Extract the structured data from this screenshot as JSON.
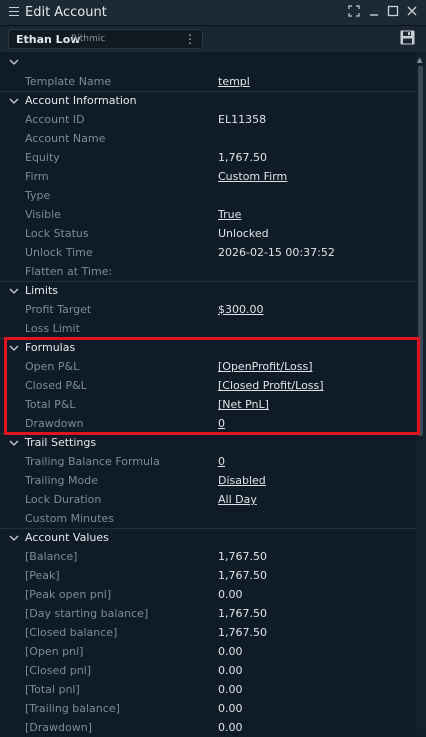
{
  "window": {
    "title": "Edit Account",
    "controls": [
      "maximize-icon",
      "minimize-icon",
      "restore-icon",
      "close-icon"
    ]
  },
  "account_selector": {
    "name": "Ethan Low",
    "provider": "Rithmic"
  },
  "colors": {
    "background": "#0f1c27",
    "label": "#7f8a94",
    "value": "#dfe3e6",
    "highlight": "#e0141f"
  },
  "grid": {
    "top": {
      "rows": [
        {
          "label": "Template Name",
          "value": "templ",
          "link": true
        }
      ]
    },
    "account_information": {
      "title": "Account Information",
      "rows": [
        {
          "label": "Account ID",
          "value": "EL11358",
          "link": false
        },
        {
          "label": "Account Name",
          "value": "",
          "link": false
        },
        {
          "label": "Equity",
          "value": "1,767.50",
          "link": false
        },
        {
          "label": "Firm",
          "value": "Custom Firm",
          "link": true
        },
        {
          "label": "Type",
          "value": "",
          "link": false
        },
        {
          "label": "Visible",
          "value": "True",
          "link": true
        },
        {
          "label": "Lock Status",
          "value": "Unlocked",
          "link": false
        },
        {
          "label": "Unlock Time",
          "value": "2026-02-15 00:37:52",
          "link": false
        },
        {
          "label": "Flatten at Time:",
          "value": "",
          "link": false
        }
      ]
    },
    "limits": {
      "title": "Limits",
      "rows": [
        {
          "label": "Profit Target",
          "value": "$300.00",
          "link": true
        },
        {
          "label": "Loss Limit",
          "value": "",
          "link": false
        }
      ]
    },
    "formulas": {
      "title": "Formulas",
      "rows": [
        {
          "label": "Open P&L",
          "value": "[OpenProfit/Loss]",
          "link": true
        },
        {
          "label": "Closed P&L",
          "value": "[Closed Profit/Loss]",
          "link": true
        },
        {
          "label": "Total P&L",
          "value": "[Net PnL]",
          "link": true
        },
        {
          "label": "Drawdown",
          "value": "0",
          "link": true
        }
      ]
    },
    "trail_settings": {
      "title": "Trail Settings",
      "rows": [
        {
          "label": "Trailing Balance Formula",
          "value": "0",
          "link": true
        },
        {
          "label": "Trailing Mode",
          "value": "Disabled",
          "link": true
        },
        {
          "label": "Lock Duration",
          "value": "All Day",
          "link": true
        },
        {
          "label": "Custom Minutes",
          "value": "",
          "link": false
        }
      ]
    },
    "account_values": {
      "title": "Account Values",
      "rows": [
        {
          "label": "[Balance]",
          "value": "1,767.50",
          "link": false
        },
        {
          "label": "[Peak]",
          "value": "1,767.50",
          "link": false
        },
        {
          "label": "[Peak open pnl]",
          "value": "0.00",
          "link": false
        },
        {
          "label": "[Day starting balance]",
          "value": "1,767.50",
          "link": false
        },
        {
          "label": "[Closed balance]",
          "value": "1,767.50",
          "link": false
        },
        {
          "label": "[Open pnl]",
          "value": "0.00",
          "link": false
        },
        {
          "label": "[Closed pnl]",
          "value": "0.00",
          "link": false
        },
        {
          "label": "[Total pnl]",
          "value": "0.00",
          "link": false
        },
        {
          "label": "[Trailing balance]",
          "value": "0.00",
          "link": false
        },
        {
          "label": "[Drawdown]",
          "value": "0.00",
          "link": false
        }
      ]
    }
  }
}
